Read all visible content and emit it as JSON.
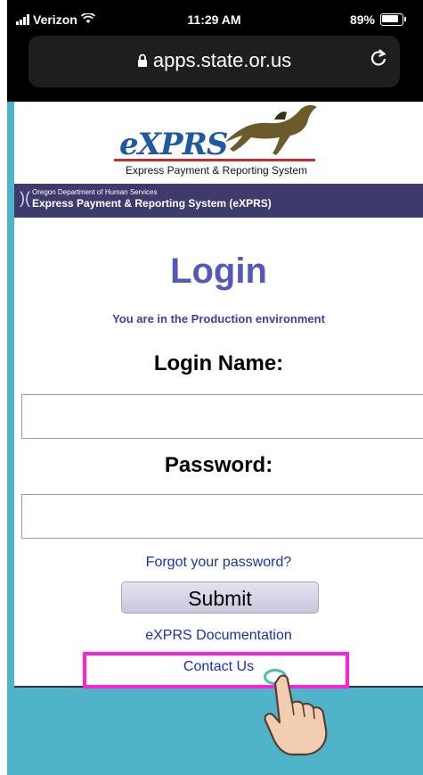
{
  "status_bar": {
    "carrier": "Verizon",
    "time": "11:29 AM",
    "battery": "89%",
    "battery_level": 0.89
  },
  "browser": {
    "url": "apps.state.or.us",
    "lock_icon": "lock-icon",
    "reload_icon": "reload-icon"
  },
  "banner": {
    "logo_text": "eXPRS",
    "tagline": "Express Payment & Reporting System",
    "dept": "Oregon Department of Human Services",
    "system": "Express Payment & Reporting System (eXPRS)"
  },
  "login": {
    "title": "Login",
    "environment": "You are in the Production environment",
    "login_name_label": "Login Name:",
    "login_name_value": "",
    "password_label": "Password:",
    "password_value": "",
    "forgot_link": "Forgot your password?",
    "submit_label": "Submit",
    "docs_link": "eXPRS Documentation",
    "contact_link": "Contact Us"
  },
  "colors": {
    "accent_title": "#5658b8",
    "link": "#1a2fb3",
    "highlight": "#ff20d8",
    "background_teal": "#4fb4c9",
    "ribbon": "#3f3a6c"
  }
}
